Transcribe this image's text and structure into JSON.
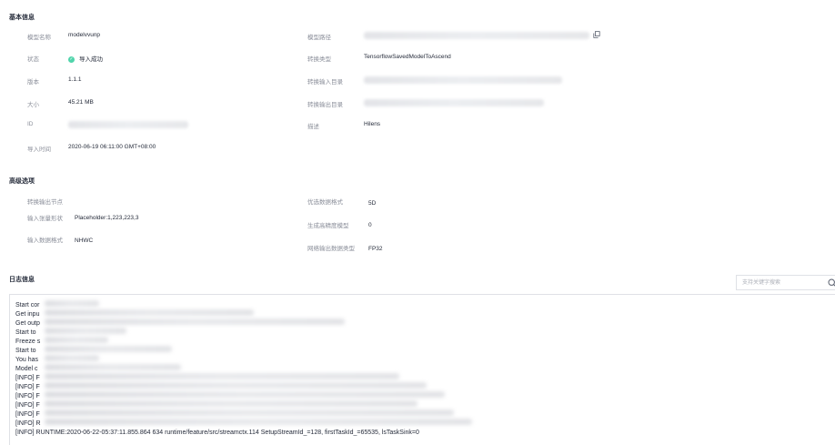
{
  "basic_info": {
    "title": "基本信息",
    "left": [
      {
        "label": "模型名称",
        "value": "modelvvunp"
      },
      {
        "label": "状态",
        "value": "导入成功"
      },
      {
        "label": "版本",
        "value": "1.1.1"
      },
      {
        "label": "大小",
        "value": "45.21 MB"
      },
      {
        "label": "ID",
        "value": ""
      },
      {
        "label": "导入时间",
        "value": "2020-06-19 06:11:00 GMT+08:00"
      }
    ],
    "right": [
      {
        "label": "模型路径",
        "value": ""
      },
      {
        "label": "转换类型",
        "value": "TensorflowSavedModelToAscend"
      },
      {
        "label": "转换输入目录",
        "value": ""
      },
      {
        "label": "转换输出目录",
        "value": ""
      },
      {
        "label": "描述",
        "value": "Hilens"
      }
    ],
    "status_color": "#50d4ab"
  },
  "advanced": {
    "title": "高级选项",
    "left": [
      {
        "label": "转换输出节点",
        "value": ""
      },
      {
        "label": "输入张量形状",
        "value": "Placeholder:1,223,223,3"
      },
      {
        "label": "输入数据格式",
        "value": "NHWC"
      }
    ],
    "right": [
      {
        "label": "优选数据格式",
        "value": "5D"
      },
      {
        "label": "生成高精度模型",
        "value": "0"
      },
      {
        "label": "网络输出数据类型",
        "value": "FP32"
      }
    ]
  },
  "log": {
    "title": "日志信息",
    "search_placeholder": "支持关键字搜索",
    "lines": [
      "Start cor",
      "Get inpu",
      "Get outp",
      "Start to",
      "Freeze s",
      "Start to",
      "You has",
      "Model c",
      "[INFO] F",
      "[INFO] F",
      "[INFO] F",
      "[INFO] F",
      "[INFO] F",
      "[INFO] R",
      "[INFO] RUNTIME:2020-06-22-05:37:11.855.864 634 runtime/feature/src/streamctx.114 SetupStreamId_=128, firstTaskId_=65535, lsTaskSink=0"
    ]
  }
}
